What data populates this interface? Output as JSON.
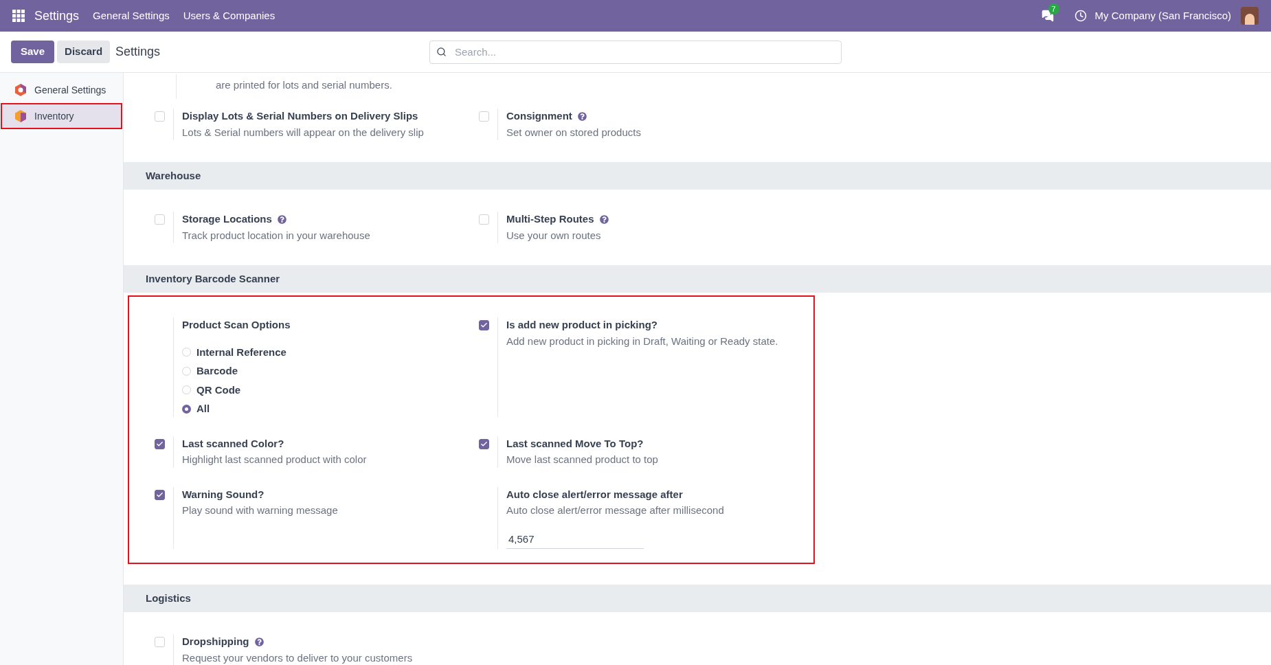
{
  "topbar": {
    "app": "Settings",
    "menu": [
      "General Settings",
      "Users & Companies"
    ],
    "messages_badge": "7",
    "company": "My Company (San Francisco)"
  },
  "control_bar": {
    "save": "Save",
    "discard": "Discard",
    "title": "Settings",
    "search": {
      "placeholder": "Search..."
    }
  },
  "sidebar": {
    "items": [
      {
        "label": "General Settings",
        "selected": false,
        "highlighted": false
      },
      {
        "label": "Inventory",
        "selected": true,
        "highlighted": true
      }
    ]
  },
  "sections": [
    {
      "continued_text": "are printed for lots and serial numbers.",
      "highlighted": false,
      "settings": [
        {
          "kind": "checkbox",
          "label": "Display Lots & Serial Numbers on Delivery Slips",
          "description": "Lots & Serial numbers will appear on the delivery slip",
          "checked": false,
          "help": false
        },
        {
          "kind": "checkbox",
          "label": "Consignment",
          "description": "Set owner on stored products",
          "checked": false,
          "help": true
        }
      ]
    },
    {
      "title": "Warehouse",
      "highlighted": false,
      "settings": [
        {
          "kind": "checkbox",
          "label": "Storage Locations",
          "description": "Track product location in your warehouse",
          "checked": false,
          "help": true
        },
        {
          "kind": "checkbox",
          "label": "Multi-Step Routes",
          "description": "Use your own routes",
          "checked": false,
          "help": true
        }
      ]
    },
    {
      "title": "Inventory Barcode Scanner",
      "highlighted": true,
      "settings": [
        {
          "kind": "radio_group",
          "label": "Product Scan Options",
          "options": [
            {
              "label": "Internal Reference",
              "selected": false
            },
            {
              "label": "Barcode",
              "selected": false
            },
            {
              "label": "QR Code",
              "selected": false
            },
            {
              "label": "All",
              "selected": true
            }
          ]
        },
        {
          "kind": "checkbox",
          "label": "Is add new product in picking?",
          "description": "Add new product in picking in Draft, Waiting or Ready state.",
          "checked": true,
          "help": false
        },
        {
          "kind": "checkbox",
          "label": "Last scanned Color?",
          "description": "Highlight last scanned product with color",
          "checked": true,
          "help": false
        },
        {
          "kind": "checkbox",
          "label": "Last scanned Move To Top?",
          "description": "Move last scanned product to top",
          "checked": true,
          "help": false
        },
        {
          "kind": "checkbox",
          "label": "Warning Sound?",
          "description": "Play sound with warning message",
          "checked": true,
          "help": false
        },
        {
          "kind": "number",
          "label": "Auto close alert/error message after",
          "description": "Auto close alert/error message after millisecond",
          "value": "4,567"
        }
      ]
    },
    {
      "title": "Logistics",
      "highlighted": false,
      "settings": [
        {
          "kind": "checkbox",
          "label": "Dropshipping",
          "description": "Request your vendors to deliver to your customers",
          "checked": false,
          "help": true
        }
      ]
    }
  ]
}
